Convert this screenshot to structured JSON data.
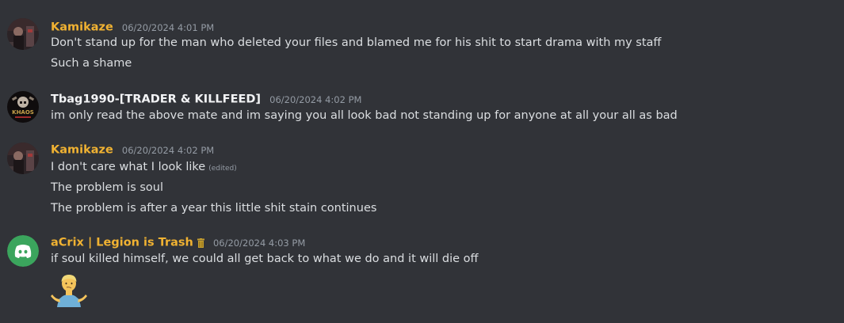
{
  "colors": {
    "background": "#313338",
    "username_gold": "#f0b232",
    "username_white": "#f2f3f5",
    "text": "#dbdee1",
    "timestamp": "#949ba4",
    "discord_green": "#3ba55d"
  },
  "messages": [
    {
      "author": "Kamikaze",
      "timestamp": "06/20/2024 4:01 PM",
      "lines": [
        "Don't stand up for the man who deleted your files and blamed me for his shit to start drama with my staff",
        "Such a shame"
      ]
    },
    {
      "author": "Tbag1990-[TRADER & KILLFEED]",
      "timestamp": "06/20/2024 4:02 PM",
      "avatar_text_top": "KHAOS",
      "lines": [
        "im only read the above mate and im saying you all look bad not standing up for anyone at all your all as bad"
      ]
    },
    {
      "author": "Kamikaze",
      "timestamp": "06/20/2024 4:02 PM",
      "edited_label": "(edited)",
      "lines": [
        "I don't care what I look like",
        "The problem is soul",
        "The problem is after a year this little shit stain continues"
      ]
    },
    {
      "author": "aCrix | Legion is Trash",
      "timestamp": "06/20/2024 4:03 PM",
      "author_icon": "trash-can-icon",
      "lines": [
        "if soul killed himself, we could all get back to what we do and it will die off"
      ],
      "emoji": "person-shrugging-emoji"
    }
  ]
}
